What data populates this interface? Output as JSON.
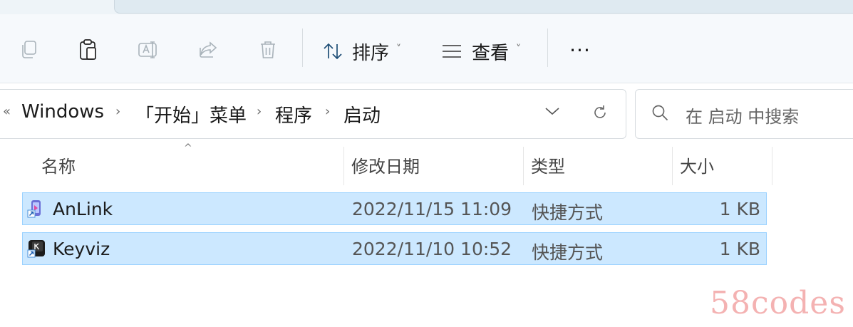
{
  "toolbar": {
    "sort_label": "排序",
    "view_label": "查看",
    "more_label": "···",
    "chevron": "˅"
  },
  "address": {
    "overflow": "«",
    "separator": "›",
    "crumbs": [
      "Windows",
      "「开始」菜单",
      "程序",
      "启动"
    ]
  },
  "search": {
    "placeholder": "在 启动 中搜索"
  },
  "columns": {
    "sort_caret": "^",
    "name": "名称",
    "date": "修改日期",
    "type": "类型",
    "size": "大小"
  },
  "files": [
    {
      "name": "AnLink",
      "date": "2022/11/15 11:09",
      "type": "快捷方式",
      "size": "1 KB",
      "icon": "anlink-shortcut-icon"
    },
    {
      "name": "Keyviz",
      "date": "2022/11/10 10:52",
      "type": "快捷方式",
      "size": "1 KB",
      "icon": "keyviz-shortcut-icon"
    }
  ],
  "watermark": "58codes",
  "colors": {
    "selection": "#cce8ff",
    "selection_border": "#99d1ff",
    "toolbar_bg": "#f6f9fc"
  }
}
